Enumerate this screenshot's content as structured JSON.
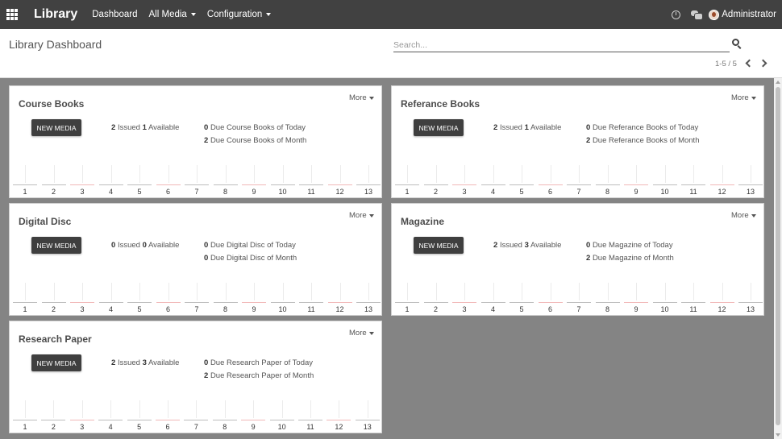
{
  "navbar": {
    "brand": "Library",
    "items": [
      {
        "label": "Dashboard"
      },
      {
        "label": "All Media"
      },
      {
        "label": "Configuration"
      }
    ],
    "user": "Administrator"
  },
  "control_panel": {
    "title": "Library Dashboard",
    "search_placeholder": "Search...",
    "pager": "1-5 / 5"
  },
  "chart_labels": [
    "1",
    "2",
    "3",
    "4",
    "5",
    "6",
    "7",
    "8",
    "9",
    "10",
    "11",
    "12",
    "13"
  ],
  "chart_base_colors": [
    "#bdbdbd",
    "#bdbdbd",
    "#f1b8b8",
    "#bdbdbd",
    "#bdbdbd",
    "#f1b8b8",
    "#bdbdbd",
    "#bdbdbd",
    "#f1b8b8",
    "#bdbdbd",
    "#bdbdbd",
    "#f1b8b8",
    "#bdbdbd"
  ],
  "cards": [
    {
      "title": "Course Books",
      "more": "More",
      "button": "NEW MEDIA",
      "issued": "2",
      "issued_text": "Issued",
      "available": "1",
      "available_text": "Available",
      "due_today": "0",
      "due_today_text": "Due Course Books of Today",
      "due_month": "2",
      "due_month_text": "Due Course Books of Month"
    },
    {
      "title": "Referance Books",
      "more": "More",
      "button": "NEW MEDIA",
      "issued": "2",
      "issued_text": "Issued",
      "available": "1",
      "available_text": "Available",
      "due_today": "0",
      "due_today_text": "Due Referance Books of Today",
      "due_month": "2",
      "due_month_text": "Due Referance Books of Month"
    },
    {
      "title": "Digital Disc",
      "more": "More",
      "button": "NEW MEDIA",
      "issued": "0",
      "issued_text": "Issued",
      "available": "0",
      "available_text": "Available",
      "due_today": "0",
      "due_today_text": "Due Digital Disc of Today",
      "due_month": "0",
      "due_month_text": "Due Digital Disc of Month"
    },
    {
      "title": "Magazine",
      "more": "More",
      "button": "NEW MEDIA",
      "issued": "2",
      "issued_text": "Issued",
      "available": "3",
      "available_text": "Available",
      "due_today": "0",
      "due_today_text": "Due Magazine of Today",
      "due_month": "2",
      "due_month_text": "Due Magazine of Month"
    },
    {
      "title": "Research Paper",
      "more": "More",
      "button": "NEW MEDIA",
      "issued": "2",
      "issued_text": "Issued",
      "available": "3",
      "available_text": "Available",
      "due_today": "0",
      "due_today_text": "Due Research Paper of Today",
      "due_month": "2",
      "due_month_text": "Due Research Paper of Month"
    }
  ]
}
